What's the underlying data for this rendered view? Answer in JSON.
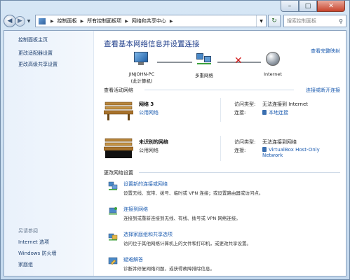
{
  "window": {
    "controls": {
      "minimize": "–",
      "maximize": "□",
      "close": "✕"
    }
  },
  "navigation": {
    "back_icon": "back-arrow-icon",
    "forward_icon": "forward-arrow-icon",
    "breadcrumb": [
      "控制面板",
      "所有控制面板项",
      "网络和共享中心"
    ],
    "search_placeholder": "搜索控制面板"
  },
  "sidebar": {
    "items": [
      {
        "label": "控制面板主页"
      },
      {
        "label": "更改适配器设置"
      },
      {
        "label": "更改高级共享设置"
      }
    ],
    "see_also_header": "另请参阅",
    "see_also": [
      {
        "label": "Internet 选项"
      },
      {
        "label": "Windows 防火墙"
      },
      {
        "label": "家庭组"
      }
    ]
  },
  "main": {
    "title": "查看基本网络信息并设置连接",
    "view_full_map": "查看完整映射",
    "map": {
      "computer_name": "JINJOHN-PC",
      "computer_sub": "(此计算机)",
      "network_label": "多重网络",
      "internet_label": "Internet"
    },
    "active_networks_header": "查看活动网络",
    "connect_disconnect": "连接或断开连接",
    "networks": [
      {
        "name": "网络  3",
        "type": "公用网络",
        "access_label": "访问类型:",
        "access_value": "无法连接到 Internet",
        "conn_label": "连接:",
        "conn_value": "本地连接",
        "conn_value2": ""
      },
      {
        "name": "未识别的网络",
        "type": "公用网络",
        "access_label": "访问类型:",
        "access_value": "无法连接到网络",
        "conn_label": "连接:",
        "conn_value": "VirtualBox Host-Only",
        "conn_value2": "Network"
      }
    ],
    "change_settings_header": "更改网络设置",
    "tasks": [
      {
        "title": "设置新的连接或网络",
        "desc": "设置无线、宽带、拨号、临时或 VPN 连接；或设置路由器或访问点。"
      },
      {
        "title": "连接到网络",
        "desc": "连接到或重新连接到无线、有线、拨号或 VPN 网络连接。"
      },
      {
        "title": "选择家庭组和共享选项",
        "desc": "访问位于其他网络计算机上的文件和打印机，或更改共享设置。"
      },
      {
        "title": "疑难解答",
        "desc": "诊断并修复网络问题，或获得故障排除信息。"
      }
    ]
  },
  "colors": {
    "link": "#1c5cb0",
    "title": "#1e3d8a",
    "error_x": "#d21b1b"
  }
}
